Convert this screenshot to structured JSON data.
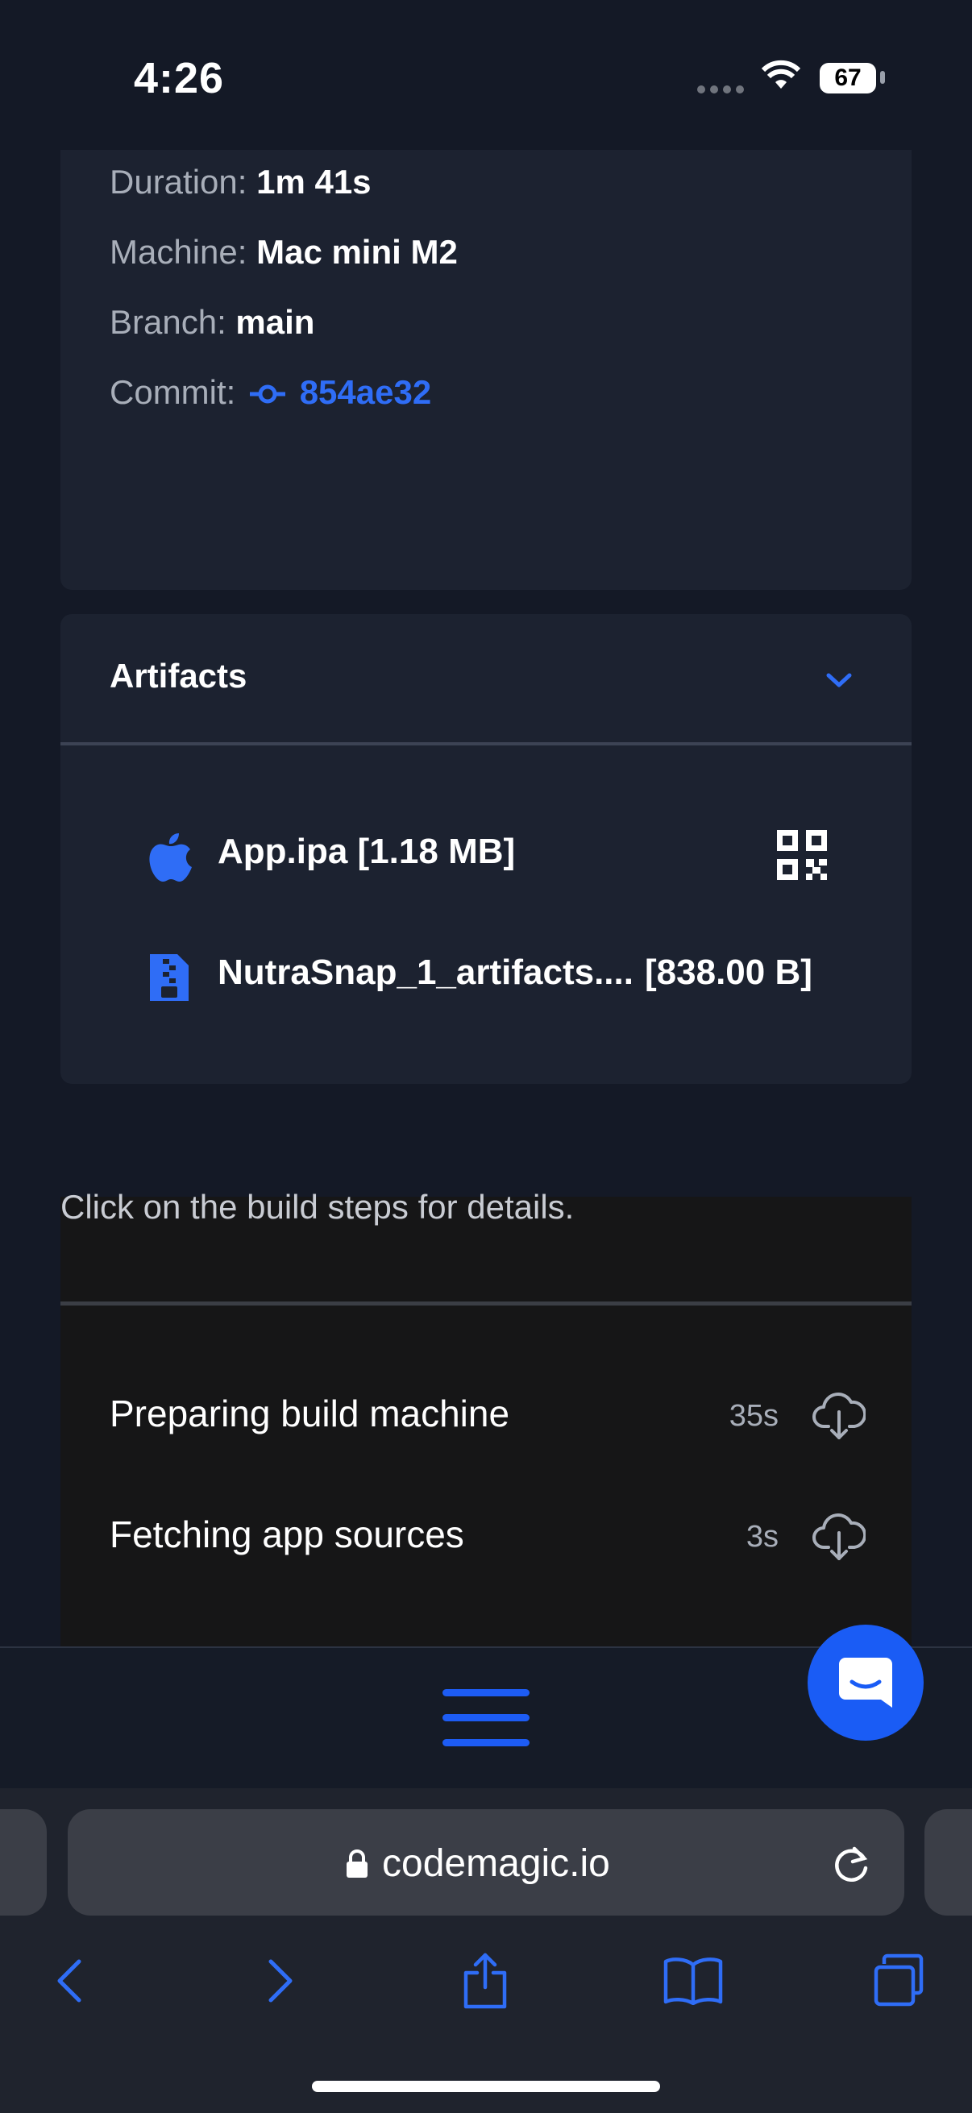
{
  "status_bar": {
    "time": "4:26",
    "battery": "67"
  },
  "build_info": {
    "duration_label": "Duration:",
    "duration_value": "1m 41s",
    "machine_label": "Machine:",
    "machine_value": "Mac mini M2",
    "branch_label": "Branch:",
    "branch_value": "main",
    "commit_label": "Commit:",
    "commit_value": "854ae32"
  },
  "artifacts": {
    "title": "Artifacts",
    "items": [
      {
        "name": "App.ipa [1.18 MB]",
        "icon": "apple-icon"
      },
      {
        "name": "NutraSnap_1_artifacts....",
        "size": "[838.00 B]",
        "icon": "zip-file-icon"
      }
    ]
  },
  "steps": {
    "hint": "Click on the build steps for details.",
    "items": [
      {
        "label": "Preparing build machine",
        "duration": "35s"
      },
      {
        "label": "Fetching app sources",
        "duration": "3s"
      }
    ]
  },
  "browser": {
    "url": "codemagic.io"
  },
  "colors": {
    "accent": "#1a5cf5",
    "background": "#141926",
    "card": "#1c2230"
  }
}
